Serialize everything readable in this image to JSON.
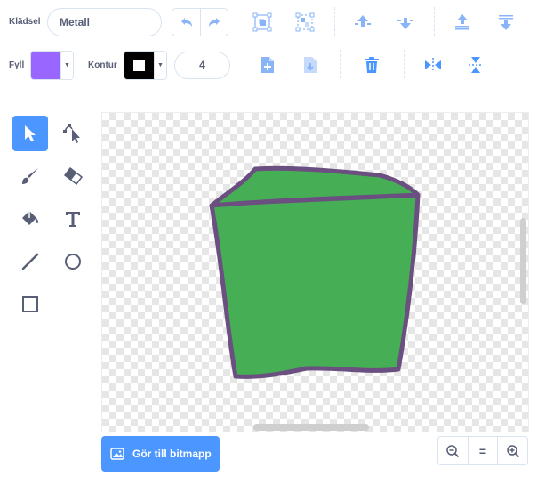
{
  "costume": {
    "label": "Klädsel",
    "name_value": "Metall"
  },
  "fill": {
    "label": "Fyll",
    "color": "#9966ff"
  },
  "outline": {
    "label": "Kontur",
    "color": "#000000",
    "width_value": "4"
  },
  "convert": {
    "label": "Gör till bitmapp"
  },
  "toolbar_icons": [
    "undo-icon",
    "redo-icon",
    "group-icon",
    "ungroup-icon",
    "forward-icon",
    "backward-icon",
    "front-icon",
    "back-icon",
    "copy-icon",
    "paste-icon",
    "delete-icon",
    "flip-horizontal-icon",
    "flip-vertical-icon"
  ],
  "tools": [
    "select",
    "reshape",
    "brush",
    "eraser",
    "fill",
    "text",
    "line",
    "circle",
    "rectangle"
  ],
  "zoom": {
    "out": "zoom-out",
    "reset": "=",
    "in": "zoom-in"
  },
  "colors": {
    "accent": "#4c97ff",
    "shape_fill": "#46af55",
    "shape_stroke": "#6b4f80"
  }
}
